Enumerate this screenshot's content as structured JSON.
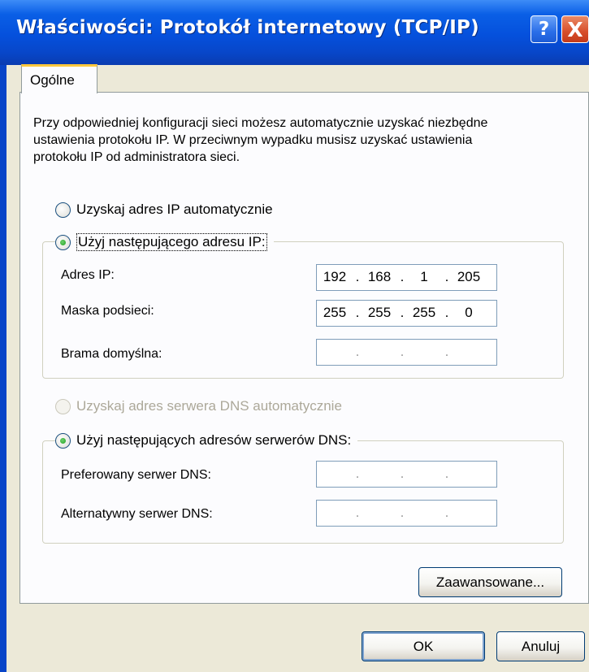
{
  "window": {
    "title": "Właściwości: Protokół internetowy (TCP/IP)",
    "help_icon": "?",
    "close_icon": "X"
  },
  "tabs": [
    {
      "label": "Ogólne",
      "selected": true
    }
  ],
  "description": "Przy odpowiedniej konfiguracji sieci możesz automatycznie uzyskać niezbędne ustawienia protokołu IP. W przeciwnym wypadku musisz uzyskać ustawienia protokołu IP od administratora sieci.",
  "ip_section": {
    "auto_label": "Uzyskaj adres IP automatycznie",
    "manual_label": "Użyj następującego adresu IP:",
    "selected": "manual",
    "fields": {
      "ip": {
        "label": "Adres IP:",
        "octets": [
          "192",
          "168",
          "1",
          "205"
        ]
      },
      "mask": {
        "label": "Maska podsieci:",
        "octets": [
          "255",
          "255",
          "255",
          "0"
        ]
      },
      "gateway": {
        "label": "Brama domyślna:",
        "octets": [
          "",
          "",
          "",
          ""
        ]
      }
    }
  },
  "dns_section": {
    "auto_label": "Uzyskaj adres serwera DNS automatycznie",
    "manual_label": "Użyj następujących adresów serwerów DNS:",
    "selected": "manual",
    "fields": {
      "preferred": {
        "label": "Preferowany serwer DNS:",
        "octets": [
          "",
          "",
          "",
          ""
        ]
      },
      "alternate": {
        "label": "Alternatywny serwer DNS:",
        "octets": [
          "",
          "",
          "",
          ""
        ]
      }
    }
  },
  "buttons": {
    "advanced": "Zaawansowane...",
    "ok": "OK",
    "cancel": "Anuluj"
  },
  "colors": {
    "titlebar": "#0550dc",
    "dialog_bg": "#ece9d8",
    "panel_bg": "#fcfcfe",
    "tab_highlight": "#ffc83c",
    "radio_dot": "#21a121",
    "close_button": "#d74e2a"
  }
}
